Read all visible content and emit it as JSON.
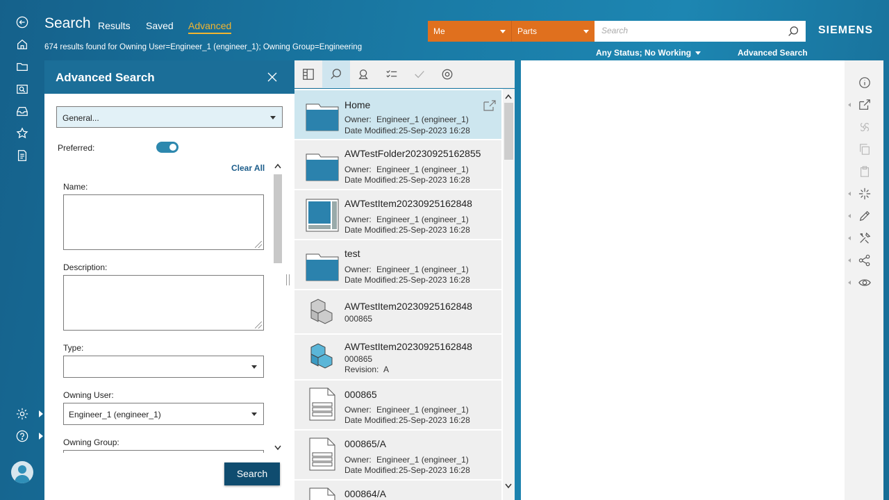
{
  "header": {
    "title": "Search",
    "tabs": [
      {
        "label": "Results"
      },
      {
        "label": "Saved"
      },
      {
        "label": "Advanced"
      }
    ],
    "results_summary": "674 results found for Owning User=Engineer_1 (engineer_1); Owning Group=Engineering",
    "scope_owner": "Me",
    "scope_type": "Parts",
    "search_placeholder": "Search",
    "brand": "SIEMENS",
    "status_filter": "Any Status; No Working",
    "advanced_search_link": "Advanced Search",
    "accent_color": "#e0701e"
  },
  "panel": {
    "title": "Advanced Search",
    "query_select": "General...",
    "preferred_label": "Preferred:",
    "preferred_on": true,
    "clear_all": "Clear All",
    "name_label": "Name:",
    "description_label": "Description:",
    "type_label": "Type:",
    "type_value": "",
    "owning_user_label": "Owning User:",
    "owning_user_value": "Engineer_1 (engineer_1)",
    "owning_group_label": "Owning Group:",
    "search_button": "Search"
  },
  "results": [
    {
      "name": "Home",
      "icon": "folder-icon",
      "k1": "Owner:",
      "v1": "Engineer_1 (engineer_1)",
      "k2": "Date Modified:",
      "v2": "25-Sep-2023 16:28"
    },
    {
      "name": "AWTestFolder20230925162855",
      "icon": "folder-icon",
      "k1": "Owner:",
      "v1": "Engineer_1 (engineer_1)",
      "k2": "Date Modified:",
      "v2": "25-Sep-2023 16:28"
    },
    {
      "name": "AWTestItem20230925162848",
      "icon": "item-icon",
      "k1": "Owner:",
      "v1": "Engineer_1 (engineer_1)",
      "k2": "Date Modified:",
      "v2": "25-Sep-2023 16:28"
    },
    {
      "name": "test",
      "icon": "folder-icon",
      "k1": "Owner:",
      "v1": "Engineer_1 (engineer_1)",
      "k2": "Date Modified:",
      "v2": "25-Sep-2023 16:28"
    },
    {
      "name": "AWTestItem20230925162848",
      "icon": "part-gray-icon",
      "id": "000865"
    },
    {
      "name": "AWTestItem20230925162848",
      "icon": "part-blue-icon",
      "id": "000865",
      "k3": "Revision:",
      "v3": "A"
    },
    {
      "name": "000865",
      "icon": "document-icon",
      "k1": "Owner:",
      "v1": "Engineer_1 (engineer_1)",
      "k2": "Date Modified:",
      "v2": "25-Sep-2023 16:28"
    },
    {
      "name": "000865/A",
      "icon": "document-icon",
      "k1": "Owner:",
      "v1": "Engineer_1 (engineer_1)",
      "k2": "Date Modified:",
      "v2": "25-Sep-2023 16:28"
    },
    {
      "name": "000864/A",
      "icon": "document-icon"
    }
  ]
}
